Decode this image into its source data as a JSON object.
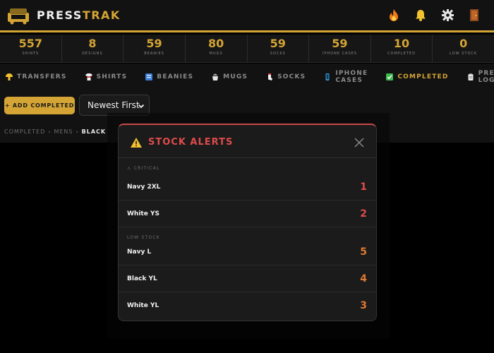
{
  "header": {
    "brand_part1": "PRESS",
    "brand_part2": "TRAK",
    "icons": [
      "fire-icon",
      "bell-icon",
      "gear-icon",
      "door-icon"
    ]
  },
  "stats": [
    {
      "value": "557",
      "label": "SHIRTS"
    },
    {
      "value": "8",
      "label": "DESIGNS"
    },
    {
      "value": "59",
      "label": "BEANIES"
    },
    {
      "value": "80",
      "label": "MUGS"
    },
    {
      "value": "59",
      "label": "SOCKS"
    },
    {
      "value": "59",
      "label": "IPHONE CASES"
    },
    {
      "value": "10",
      "label": "COMPLETED"
    },
    {
      "value": "0",
      "label": "LOW STOCK"
    }
  ],
  "nav": [
    {
      "label": "TRANSFERS",
      "icon": "mushroom-icon"
    },
    {
      "label": "SHIRTS",
      "icon": "shirt-icon"
    },
    {
      "label": "BEANIES",
      "icon": "beanie-icon"
    },
    {
      "label": "MUGS",
      "icon": "mug-icon"
    },
    {
      "label": "SOCKS",
      "icon": "sock-icon"
    },
    {
      "label": "IPHONE CASES",
      "icon": "phone-icon"
    },
    {
      "label": "COMPLETED",
      "icon": "check-icon",
      "active": true
    },
    {
      "label": "PRESS LOG",
      "icon": "clipboard-icon"
    }
  ],
  "toolbar": {
    "add_label": "+ ADD COMPLETED",
    "sort_value": "Newest First"
  },
  "breadcrumb": [
    "COMPLETED",
    "MENS",
    "BLACK"
  ],
  "modal": {
    "title": "STOCK ALERTS",
    "critical_label": "⚠ CRITICAL",
    "low_label": "LOW STOCK",
    "critical": [
      {
        "name": "Navy 2XL",
        "qty": "1"
      },
      {
        "name": "White YS",
        "qty": "2"
      }
    ],
    "low": [
      {
        "name": "Navy L",
        "qty": "5"
      },
      {
        "name": "Black YL",
        "qty": "4"
      },
      {
        "name": "White YL",
        "qty": "3"
      }
    ]
  },
  "colors": {
    "accent": "#d4a535",
    "critical": "#e04b4b",
    "low": "#e07a30"
  }
}
